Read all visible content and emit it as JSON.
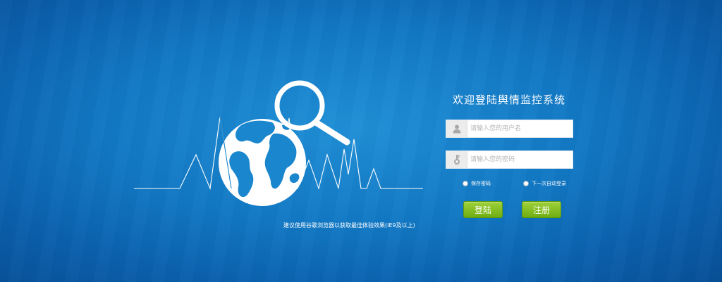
{
  "login": {
    "title": "欢迎登陆舆情监控系统",
    "username_placeholder": "请输入您的用户名",
    "password_placeholder": "请输入您的密码",
    "remember_label": "保存密码",
    "auto_login_label": "下一次自动登录",
    "login_button": "登陆",
    "register_button": "注册"
  },
  "browser_note": "建议使用谷歌浏览器以获取最佳体验效果(IE9及以上)",
  "icons": {
    "username": "user-icon",
    "password": "key-icon",
    "illustration": [
      "globe-icon",
      "magnifier-icon"
    ]
  },
  "colors": {
    "background": "#1278c4",
    "button": "#8cc425",
    "text": "#ffffff"
  }
}
